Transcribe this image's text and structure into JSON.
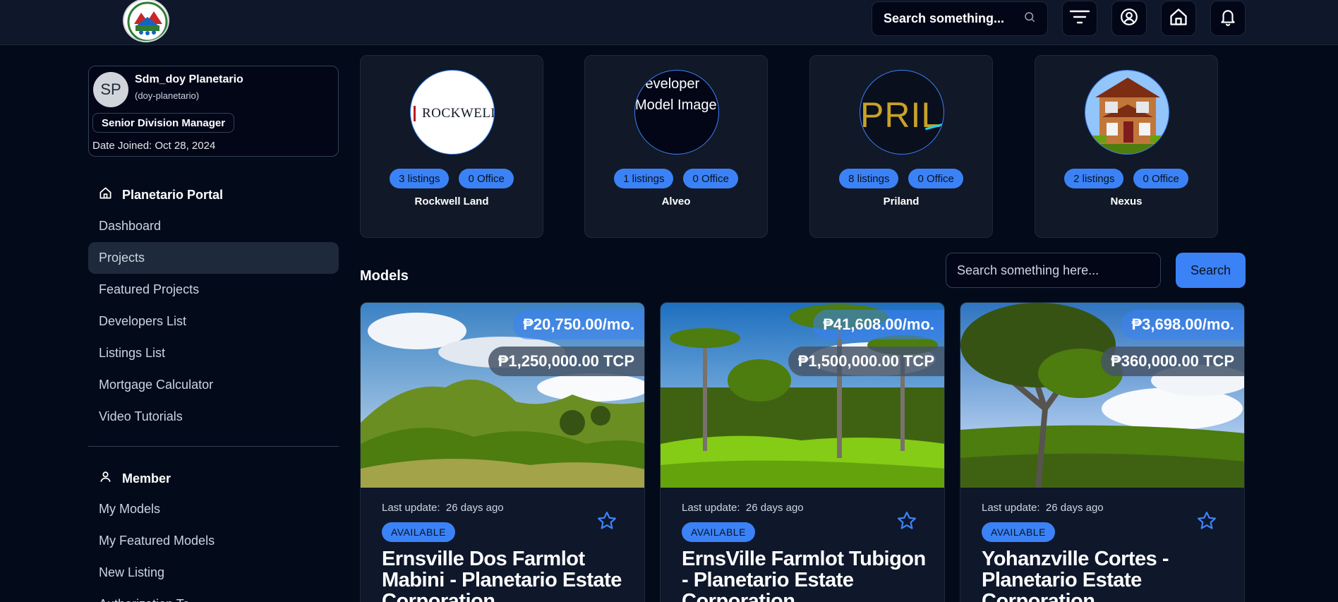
{
  "header": {
    "search_placeholder": "Search something...",
    "buttons": [
      "filter-icon",
      "user-circle-icon",
      "home-icon",
      "bell-icon"
    ]
  },
  "profile": {
    "initials": "SP",
    "name": "Sdm_doy Planetario",
    "username": "(doy-planetario)",
    "role": "Senior Division Manager",
    "date_joined": "Date Joined: Oct 28, 2024"
  },
  "sidebar": {
    "portal_title": "Planetario Portal",
    "portal_items": [
      {
        "label": "Dashboard"
      },
      {
        "label": "Projects",
        "active": true
      },
      {
        "label": "Featured Projects"
      },
      {
        "label": "Developers List"
      },
      {
        "label": "Listings List"
      },
      {
        "label": "Mortgage Calculator"
      },
      {
        "label": "Video Tutorials"
      }
    ],
    "member_title": "Member",
    "member_items": [
      {
        "label": "My Models"
      },
      {
        "label": "My Featured Models"
      },
      {
        "label": "New Listing"
      },
      {
        "label": "Authorization To..."
      }
    ]
  },
  "developers": [
    {
      "name": "Rockwell Land",
      "listings": "3 listings",
      "office": "0 Office",
      "logo_text": "ROCKWELL LA"
    },
    {
      "name": "Alveo",
      "listings": "1 listings",
      "office": "0 Office",
      "logo_text": "Developer Model Image"
    },
    {
      "name": "Priland",
      "listings": "8 listings",
      "office": "0 Office",
      "logo_text": "PRIL"
    },
    {
      "name": "Nexus",
      "listings": "2 listings",
      "office": "0 Office"
    }
  ],
  "models_section": {
    "title": "Models",
    "search_placeholder": "Search something here...",
    "search_button": "Search"
  },
  "models": [
    {
      "monthly": "₱20,750.00/mo.",
      "tcp": "₱1,250,000.00 TCP",
      "last_update_label": "Last update:",
      "last_update": "26 days ago",
      "status": "AVAILABLE",
      "title": "Ernsville Dos Farmlot Mabini - Planetario Estate Corporation"
    },
    {
      "monthly": "₱41,608.00/mo.",
      "tcp": "₱1,500,000.00 TCP",
      "last_update_label": "Last update:",
      "last_update": "26 days ago",
      "status": "AVAILABLE",
      "title": "ErnsVille Farmlot Tubigon - Planetario Estate Corporation"
    },
    {
      "monthly": "₱3,698.00/mo.",
      "tcp": "₱360,000.00 TCP",
      "last_update_label": "Last update:",
      "last_update": "26 days ago",
      "status": "AVAILABLE",
      "title": "Yohanzville Cortes - Planetario Estate Corporation"
    }
  ],
  "colors": {
    "accent": "#3b82f6",
    "background": "#030a1a",
    "panel": "#111827"
  }
}
